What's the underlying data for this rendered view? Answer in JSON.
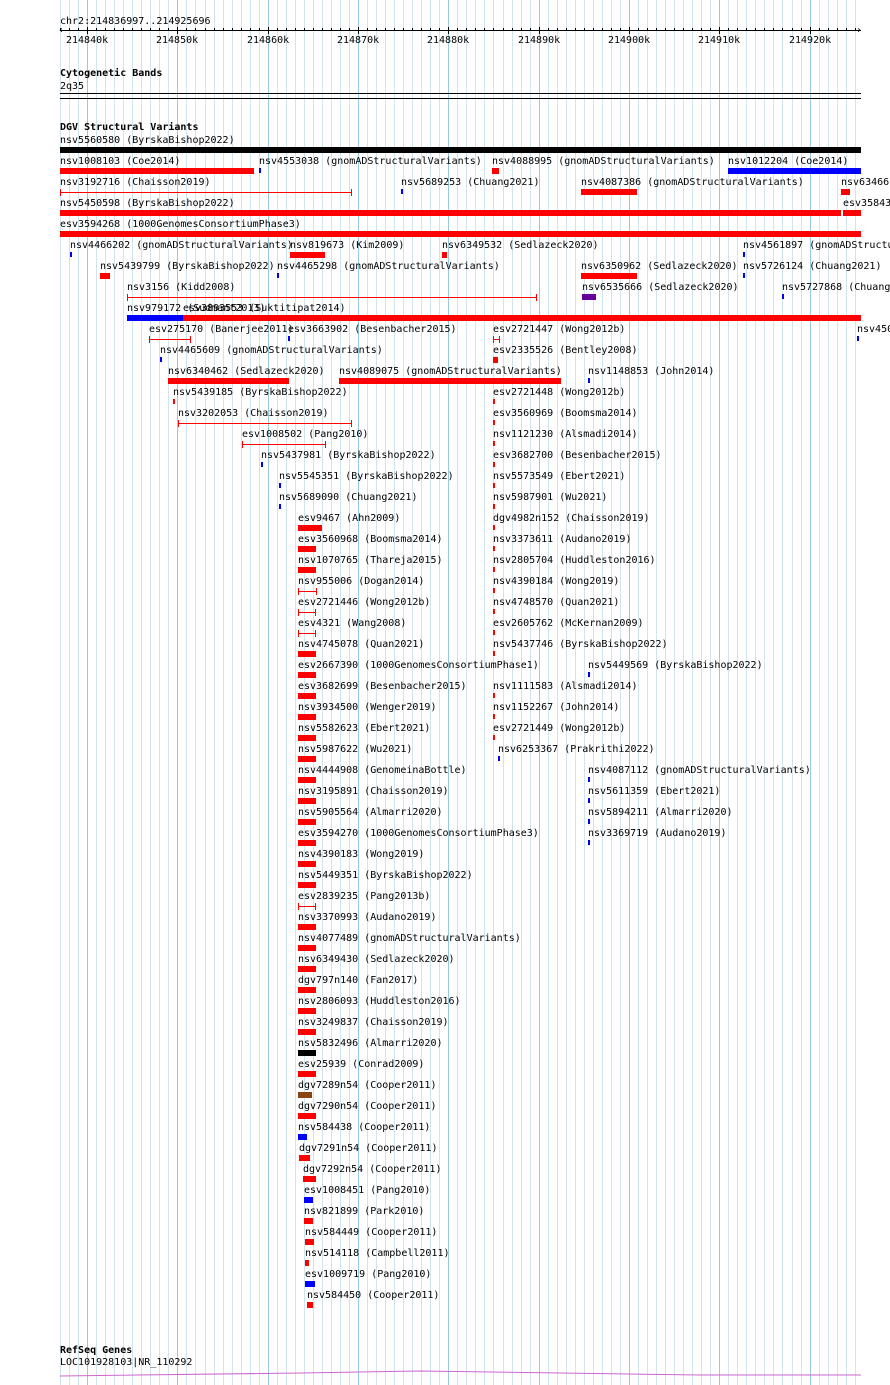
{
  "ruler": {
    "location": "chr2:214836997..214925696",
    "ticks": [
      {
        "label": "214840k",
        "pos": 214840000
      },
      {
        "label": "214850k",
        "pos": 214850000
      },
      {
        "label": "214860k",
        "pos": 214860000
      },
      {
        "label": "214870k",
        "pos": 214870000
      },
      {
        "label": "214880k",
        "pos": 214880000
      },
      {
        "label": "214890k",
        "pos": 214890000
      },
      {
        "label": "214900k",
        "pos": 214900000
      },
      {
        "label": "214910k",
        "pos": 214910000
      },
      {
        "label": "214920k",
        "pos": 214920000
      }
    ]
  },
  "tracks": {
    "cytoband": {
      "title": "Cytogenetic Bands",
      "band": "2q35"
    },
    "dgv": {
      "title": "DGV Structural Variants"
    },
    "refseq": {
      "title": "RefSeq Genes",
      "gene": "LOC101928103|NR_110292"
    }
  },
  "colors": {
    "loss": "#ff0000",
    "gain": "#0000ff",
    "complex": "#000000",
    "inversion": "#660099",
    "other": "#8b4513",
    "gene": "#cc66cc"
  },
  "features": [
    {
      "label": "nsv5560580 (ByrskaBishop2022)",
      "start": 214836997,
      "end": 214925696,
      "row": 0,
      "color": "#000000",
      "style": "thick"
    },
    {
      "label": "nsv1008103 (Coe2014)",
      "start": 214836997,
      "end": 214858500,
      "row": 1,
      "color": "#ff0000",
      "style": "thick"
    },
    {
      "label": "nsv4553038 (gnomADStructuralVariants)",
      "start": 214859000,
      "end": 214859300,
      "row": 1,
      "color": "#0000ff",
      "style": "thick"
    },
    {
      "label": "nsv4088995 (gnomADStructuralVariants)",
      "start": 214884800,
      "end": 214885600,
      "row": 1,
      "color": "#ff0000",
      "style": "thick"
    },
    {
      "label": "nsv1012204 (Coe2014)",
      "start": 214911000,
      "end": 214925696,
      "row": 1,
      "color": "#0000ff",
      "style": "thick"
    },
    {
      "label": "nsv3192716 (Chaisson2019)",
      "start": 214836997,
      "end": 214869300,
      "row": 2,
      "color": "#ff0000",
      "style": "thin"
    },
    {
      "label": "nsv5689253 (Chuang2021)",
      "start": 214874800,
      "end": 214875100,
      "row": 2,
      "color": "#0000ff",
      "style": "thick"
    },
    {
      "label": "nsv4087386 (gnomADStructuralVariants)",
      "start": 214894700,
      "end": 214900900,
      "row": 2,
      "color": "#ff0000",
      "style": "thick"
    },
    {
      "label": "nsv634661",
      "start": 214923500,
      "end": 214924500,
      "row": 2,
      "color": "#ff0000",
      "style": "thick"
    },
    {
      "label": "nsv5450598 (ByrskaBishop2022)",
      "start": 214836997,
      "end": 214923500,
      "row": 3,
      "color": "#ff0000",
      "style": "thick"
    },
    {
      "label": "esv35843",
      "start": 214923700,
      "end": 214925696,
      "row": 3,
      "color": "#ff0000",
      "style": "thick"
    },
    {
      "label": "esv3594268 (1000GenomesConsortiumPhase3)",
      "start": 214836997,
      "end": 214925696,
      "row": 4,
      "color": "#ff0000",
      "style": "thick"
    },
    {
      "label": "nsv4466202 (gnomADStructuralVariants)",
      "start": 214838100,
      "end": 214838300,
      "row": 5,
      "color": "#0000ff",
      "style": "thick"
    },
    {
      "label": "nsv819673 (Kim2009)",
      "start": 214862500,
      "end": 214866300,
      "row": 5,
      "color": "#ff0000",
      "style": "thick"
    },
    {
      "label": "nsv6349532 (Sedlazeck2020)",
      "start": 214879300,
      "end": 214879900,
      "row": 5,
      "color": "#ff0000",
      "style": "thick"
    },
    {
      "label": "nsv4561897 (gnomADStructu",
      "start": 214912600,
      "end": 214912800,
      "row": 5,
      "color": "#0000ff",
      "style": "thick"
    },
    {
      "label": "nsv5439799 (ByrskaBishop2022)",
      "start": 214841400,
      "end": 214842500,
      "row": 6,
      "color": "#ff0000",
      "style": "thick"
    },
    {
      "label": "nsv4465298 (gnomADStructuralVariants)",
      "start": 214861000,
      "end": 214861200,
      "row": 6,
      "color": "#0000ff",
      "style": "thick"
    },
    {
      "label": "nsv6350962 (Sedlazeck2020)",
      "start": 214894700,
      "end": 214900900,
      "row": 6,
      "color": "#ff0000",
      "style": "thick"
    },
    {
      "label": "nsv5726124 (Chuang2021)",
      "start": 214912600,
      "end": 214912800,
      "row": 6,
      "color": "#0000ff",
      "style": "thick"
    },
    {
      "label": "nsv3156 (Kidd2008)",
      "start": 214844400,
      "end": 214889800,
      "row": 7,
      "color": "#ff0000",
      "style": "thin"
    },
    {
      "label": "nsv6535666 (Sedlazeck2020)",
      "start": 214894800,
      "end": 214896300,
      "row": 7,
      "color": "#660099",
      "style": "thick"
    },
    {
      "label": "nsv5727868 (Chuang2",
      "start": 214917000,
      "end": 214917200,
      "row": 7,
      "color": "#0000ff",
      "style": "thick"
    },
    {
      "label": "nsv979172 (Sudmant2013)",
      "start": 214844400,
      "end": 214850600,
      "row": 8,
      "color": "#0000ff",
      "style": "thick"
    },
    {
      "label": "esv3893553 (Suktitipat2014)",
      "start": 214850600,
      "end": 214925696,
      "row": 8,
      "color": "#ff0000",
      "style": "thick"
    },
    {
      "label": "esv275170 (Banerjee2011)",
      "start": 214846900,
      "end": 214851500,
      "row": 9,
      "color": "#ff0000",
      "style": "capped"
    },
    {
      "label": "esv3663902 (Besenbacher2015)",
      "start": 214862300,
      "end": 214862500,
      "row": 9,
      "color": "#0000ff",
      "style": "thick"
    },
    {
      "label": "esv2721447 (Wong2012b)",
      "start": 214884900,
      "end": 214885700,
      "row": 9,
      "color": "#ff0000",
      "style": "capped"
    },
    {
      "label": "nsv450",
      "start": 214925200,
      "end": 214925400,
      "row": 9,
      "color": "#0000ff",
      "style": "thick"
    },
    {
      "label": "nsv4465609 (gnomADStructuralVariants)",
      "start": 214848100,
      "end": 214848300,
      "row": 10,
      "color": "#0000ff",
      "style": "thick"
    },
    {
      "label": "esv2335526 (Bentley2008)",
      "start": 214884900,
      "end": 214885500,
      "row": 10,
      "color": "#ff0000",
      "style": "thick"
    },
    {
      "label": "nsv6340462 (Sedlazeck2020)",
      "start": 214849000,
      "end": 214862400,
      "row": 11,
      "color": "#ff0000",
      "style": "thick"
    },
    {
      "label": "nsv4089075 (gnomADStructuralVariants)",
      "start": 214867900,
      "end": 214892500,
      "row": 11,
      "color": "#ff0000",
      "style": "thick"
    },
    {
      "label": "nsv1148853 (John2014)",
      "start": 214895500,
      "end": 214895700,
      "row": 11,
      "color": "#0000ff",
      "style": "thick"
    },
    {
      "label": "nsv5439185 (ByrskaBishop2022)",
      "start": 214849500,
      "end": 214849700,
      "row": 12,
      "color": "#ff0000",
      "style": "thick"
    },
    {
      "label": "esv2721448 (Wong2012b)",
      "start": 214885000,
      "end": 214885300,
      "row": 12,
      "color": "#ff0000",
      "style": "thick"
    },
    {
      "label": "nsv3202053 (Chaisson2019)",
      "start": 214850100,
      "end": 214869300,
      "row": 13,
      "color": "#ff0000",
      "style": "capped"
    },
    {
      "label": "esv3560969 (Boomsma2014)",
      "start": 214885000,
      "end": 214885300,
      "row": 13,
      "color": "#ff0000",
      "style": "thick"
    },
    {
      "label": "esv1008502 (Pang2010)",
      "start": 214857100,
      "end": 214866500,
      "row": 14,
      "color": "#ff0000",
      "style": "capped"
    },
    {
      "label": "nsv1121230 (Alsmadi2014)",
      "start": 214885000,
      "end": 214885300,
      "row": 14,
      "color": "#ff0000",
      "style": "thick"
    },
    {
      "label": "nsv5437981 (ByrskaBishop2022)",
      "start": 214859300,
      "end": 214859500,
      "row": 15,
      "color": "#0000ff",
      "style": "thick"
    },
    {
      "label": "esv3682700 (Besenbacher2015)",
      "start": 214885000,
      "end": 214885300,
      "row": 15,
      "color": "#ff0000",
      "style": "thick"
    },
    {
      "label": "nsv5545351 (ByrskaBishop2022)",
      "start": 214861200,
      "end": 214861400,
      "row": 16,
      "color": "#0000ff",
      "style": "thick"
    },
    {
      "label": "nsv5573549 (Ebert2021)",
      "start": 214885000,
      "end": 214885300,
      "row": 16,
      "color": "#ff0000",
      "style": "thick"
    },
    {
      "label": "nsv5689090 (Chuang2021)",
      "start": 214861200,
      "end": 214861400,
      "row": 17,
      "color": "#0000ff",
      "style": "thick"
    },
    {
      "label": "nsv5987901 (Wu2021)",
      "start": 214885000,
      "end": 214885300,
      "row": 17,
      "color": "#ff0000",
      "style": "thick"
    },
    {
      "label": "esv9467 (Ahn2009)",
      "start": 214863300,
      "end": 214866000,
      "row": 18,
      "color": "#ff0000",
      "style": "thick"
    },
    {
      "label": "dgv4982n152 (Chaisson2019)",
      "start": 214885000,
      "end": 214885300,
      "row": 18,
      "color": "#ff0000",
      "style": "thick"
    },
    {
      "label": "esv3560968 (Boomsma2014)",
      "start": 214863300,
      "end": 214865400,
      "row": 19,
      "color": "#ff0000",
      "style": "thick"
    },
    {
      "label": "nsv3373611 (Audano2019)",
      "start": 214885000,
      "end": 214885300,
      "row": 19,
      "color": "#ff0000",
      "style": "thick"
    },
    {
      "label": "nsv1070765 (Thareja2015)",
      "start": 214863300,
      "end": 214865400,
      "row": 20,
      "color": "#ff0000",
      "style": "thick"
    },
    {
      "label": "nsv2805704 (Huddleston2016)",
      "start": 214885000,
      "end": 214885300,
      "row": 20,
      "color": "#ff0000",
      "style": "thick"
    },
    {
      "label": "nsv955006 (Dogan2014)",
      "start": 214863300,
      "end": 214865500,
      "row": 21,
      "color": "#ff0000",
      "style": "capped"
    },
    {
      "label": "nsv4390184 (Wong2019)",
      "start": 214885000,
      "end": 214885300,
      "row": 21,
      "color": "#ff0000",
      "style": "thick"
    },
    {
      "label": "esv2721446 (Wong2012b)",
      "start": 214863300,
      "end": 214865400,
      "row": 22,
      "color": "#ff0000",
      "style": "capped"
    },
    {
      "label": "nsv4748570 (Quan2021)",
      "start": 214885000,
      "end": 214885300,
      "row": 22,
      "color": "#ff0000",
      "style": "thick"
    },
    {
      "label": "esv4321 (Wang2008)",
      "start": 214863300,
      "end": 214865400,
      "row": 23,
      "color": "#ff0000",
      "style": "capped"
    },
    {
      "label": "esv2605762 (McKernan2009)",
      "start": 214885000,
      "end": 214885300,
      "row": 23,
      "color": "#ff0000",
      "style": "thick"
    },
    {
      "label": "nsv4745078 (Quan2021)",
      "start": 214863300,
      "end": 214865400,
      "row": 24,
      "color": "#ff0000",
      "style": "thick"
    },
    {
      "label": "nsv5437746 (ByrskaBishop2022)",
      "start": 214885000,
      "end": 214885300,
      "row": 24,
      "color": "#ff0000",
      "style": "thick"
    },
    {
      "label": "esv2667390 (1000GenomesConsortiumPhase1)",
      "start": 214863300,
      "end": 214865400,
      "row": 25,
      "color": "#ff0000",
      "style": "thick"
    },
    {
      "label": "nsv5449569 (ByrskaBishop2022)",
      "start": 214895500,
      "end": 214895700,
      "row": 25,
      "color": "#0000ff",
      "style": "thick"
    },
    {
      "label": "esv3682699 (Besenbacher2015)",
      "start": 214863300,
      "end": 214865400,
      "row": 26,
      "color": "#ff0000",
      "style": "thick"
    },
    {
      "label": "nsv1111583 (Alsmadi2014)",
      "start": 214885000,
      "end": 214885300,
      "row": 26,
      "color": "#ff0000",
      "style": "thick"
    },
    {
      "label": "nsv3934500 (Wenger2019)",
      "start": 214863300,
      "end": 214865400,
      "row": 27,
      "color": "#ff0000",
      "style": "thick"
    },
    {
      "label": "nsv1152267 (John2014)",
      "start": 214885000,
      "end": 214885300,
      "row": 27,
      "color": "#ff0000",
      "style": "thick"
    },
    {
      "label": "nsv5582623 (Ebert2021)",
      "start": 214863300,
      "end": 214865400,
      "row": 28,
      "color": "#ff0000",
      "style": "thick"
    },
    {
      "label": "esv2721449 (Wong2012b)",
      "start": 214885000,
      "end": 214885300,
      "row": 28,
      "color": "#ff0000",
      "style": "thick"
    },
    {
      "label": "nsv5987622 (Wu2021)",
      "start": 214863300,
      "end": 214865400,
      "row": 29,
      "color": "#ff0000",
      "style": "thick"
    },
    {
      "label": "nsv6253367 (Prakrithi2022)",
      "start": 214885500,
      "end": 214885700,
      "row": 29,
      "color": "#0000ff",
      "style": "thick"
    },
    {
      "label": "nsv4444908 (GenomeinaBottle)",
      "start": 214863300,
      "end": 214865400,
      "row": 30,
      "color": "#ff0000",
      "style": "thick"
    },
    {
      "label": "nsv4087112 (gnomADStructuralVariants)",
      "start": 214895500,
      "end": 214895700,
      "row": 30,
      "color": "#0000ff",
      "style": "thick"
    },
    {
      "label": "nsv3195891 (Chaisson2019)",
      "start": 214863300,
      "end": 214865400,
      "row": 31,
      "color": "#ff0000",
      "style": "thick"
    },
    {
      "label": "nsv5611359 (Ebert2021)",
      "start": 214895500,
      "end": 214895700,
      "row": 31,
      "color": "#0000ff",
      "style": "thick"
    },
    {
      "label": "nsv5905564 (Almarri2020)",
      "start": 214863300,
      "end": 214865400,
      "row": 32,
      "color": "#ff0000",
      "style": "thick"
    },
    {
      "label": "nsv5894211 (Almarri2020)",
      "start": 214895500,
      "end": 214895700,
      "row": 32,
      "color": "#0000ff",
      "style": "thick"
    },
    {
      "label": "esv3594270 (1000GenomesConsortiumPhase3)",
      "start": 214863300,
      "end": 214865400,
      "row": 33,
      "color": "#ff0000",
      "style": "thick"
    },
    {
      "label": "nsv3369719 (Audano2019)",
      "start": 214895500,
      "end": 214895700,
      "row": 33,
      "color": "#0000ff",
      "style": "thick"
    },
    {
      "label": "nsv4390183 (Wong2019)",
      "start": 214863300,
      "end": 214865400,
      "row": 34,
      "color": "#ff0000",
      "style": "thick"
    },
    {
      "label": "nsv5449351 (ByrskaBishop2022)",
      "start": 214863300,
      "end": 214865400,
      "row": 35,
      "color": "#ff0000",
      "style": "thick"
    },
    {
      "label": "esv2839235 (Pang2013b)",
      "start": 214863300,
      "end": 214865400,
      "row": 36,
      "color": "#ff0000",
      "style": "capped"
    },
    {
      "label": "nsv3370993 (Audano2019)",
      "start": 214863300,
      "end": 214865400,
      "row": 37,
      "color": "#ff0000",
      "style": "thick"
    },
    {
      "label": "nsv4077489 (gnomADStructuralVariants)",
      "start": 214863300,
      "end": 214865400,
      "row": 38,
      "color": "#ff0000",
      "style": "thick"
    },
    {
      "label": "nsv6349430 (Sedlazeck2020)",
      "start": 214863300,
      "end": 214865400,
      "row": 39,
      "color": "#ff0000",
      "style": "thick"
    },
    {
      "label": "dgv797n140 (Fan2017)",
      "start": 214863300,
      "end": 214865400,
      "row": 40,
      "color": "#ff0000",
      "style": "thick"
    },
    {
      "label": "nsv2806093 (Huddleston2016)",
      "start": 214863300,
      "end": 214865400,
      "row": 41,
      "color": "#ff0000",
      "style": "thick"
    },
    {
      "label": "nsv3249837 (Chaisson2019)",
      "start": 214863300,
      "end": 214865400,
      "row": 42,
      "color": "#ff0000",
      "style": "thick"
    },
    {
      "label": "nsv5832496 (Almarri2020)",
      "start": 214863300,
      "end": 214865400,
      "row": 43,
      "color": "#000000",
      "style": "thick"
    },
    {
      "label": "esv25939 (Conrad2009)",
      "start": 214863300,
      "end": 214865400,
      "row": 44,
      "color": "#ff0000",
      "style": "thick"
    },
    {
      "label": "dgv7289n54 (Cooper2011)",
      "start": 214863400,
      "end": 214864900,
      "row": 45,
      "color": "#8b4513",
      "style": "thick"
    },
    {
      "label": "dgv7290n54 (Cooper2011)",
      "start": 214863400,
      "end": 214865300,
      "row": 46,
      "color": "#ff0000",
      "style": "thick"
    },
    {
      "label": "nsv584438 (Cooper2011)",
      "start": 214863400,
      "end": 214864400,
      "row": 47,
      "color": "#0000ff",
      "style": "thick"
    },
    {
      "label": "dgv7291n54 (Cooper2011)",
      "start": 214863500,
      "end": 214864700,
      "row": 48,
      "color": "#ff0000",
      "style": "thick"
    },
    {
      "label": "dgv7292n54 (Cooper2011)",
      "start": 214863900,
      "end": 214865300,
      "row": 49,
      "color": "#ff0000",
      "style": "thick"
    },
    {
      "label": "esv1008451 (Pang2010)",
      "start": 214864000,
      "end": 214865000,
      "row": 50,
      "color": "#0000ff",
      "style": "thick"
    },
    {
      "label": "nsv821899 (Park2010)",
      "start": 214864000,
      "end": 214865000,
      "row": 51,
      "color": "#ff0000",
      "style": "thick"
    },
    {
      "label": "nsv584449 (Cooper2011)",
      "start": 214864100,
      "end": 214865100,
      "row": 52,
      "color": "#ff0000",
      "style": "thick"
    },
    {
      "label": "nsv514118 (Campbell2011)",
      "start": 214864100,
      "end": 214864600,
      "row": 53,
      "color": "#ff0000",
      "style": "thick"
    },
    {
      "label": "esv1009719 (Pang2010)",
      "start": 214864100,
      "end": 214865200,
      "row": 54,
      "color": "#0000ff",
      "style": "thick"
    },
    {
      "label": "nsv584450 (Cooper2011)",
      "start": 214864400,
      "end": 214865000,
      "row": 55,
      "color": "#ff0000",
      "style": "thick"
    }
  ]
}
